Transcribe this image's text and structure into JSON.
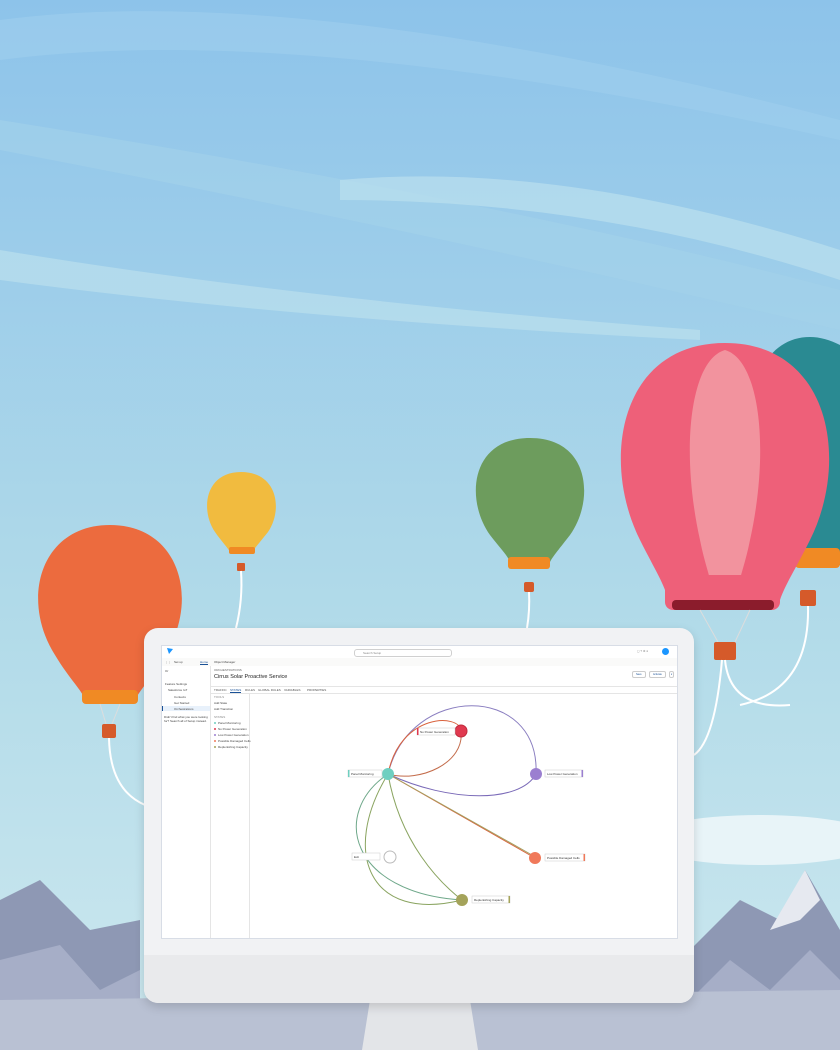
{
  "app": {
    "setup_label": "Set up",
    "home_tab": "Home",
    "object_manager_tab": "Object Manager",
    "search_placeholder": "Search Setup"
  },
  "sidebar": {
    "quick_find": "Or",
    "items": [
      "Feature Settings",
      "Salesforce IoT",
      "Contexts",
      "Get Started",
      "Orchestrations"
    ],
    "hint": "Didn't find what you were looking for? Search all of Setup instead."
  },
  "header": {
    "breadcrumb": "ORCHESTRATIONS",
    "title": "Cirrus Solar Proactive Service",
    "save_button": "Save",
    "activate_button": "Activate"
  },
  "subtabs": [
    "TRAFFIC",
    "STATES",
    "RULES",
    "GLOBAL RULES",
    "VARIABLES",
    "PROPERTIES"
  ],
  "states_panel": {
    "tools_label": "TOOLS",
    "add_state": "Add State",
    "add_transition": "Add Transition",
    "states_label": "STATES",
    "states": [
      {
        "name": "Panel Monitoring",
        "color": "#6fcfc0"
      },
      {
        "name": "No Power Generation",
        "color": "#e0394f"
      },
      {
        "name": "Low Power Generation",
        "color": "#9b7fd0"
      },
      {
        "name": "Possible Damaged Cells",
        "color": "#f0795a"
      },
      {
        "name": "Replenishing Capacity",
        "color": "#a4a35a"
      }
    ]
  },
  "diagram": {
    "nodes": [
      {
        "label": "Panel Monitoring",
        "color": "#6fcfc0"
      },
      {
        "label": "No Power Generation",
        "color": "#e0394f"
      },
      {
        "label": "Low Power Generation",
        "color": "#9b7fd0"
      },
      {
        "label": "Possible Damaged Cells",
        "color": "#f0795a"
      },
      {
        "label": "Replenishing Capacity",
        "color": "#a4a35a"
      },
      {
        "label": "Exit",
        "color": "#ffffff"
      }
    ]
  },
  "colors": {
    "sky_top": "#8cc4ea",
    "sky_bottom": "#bfe0ec",
    "brand_blue": "#1b5297"
  }
}
